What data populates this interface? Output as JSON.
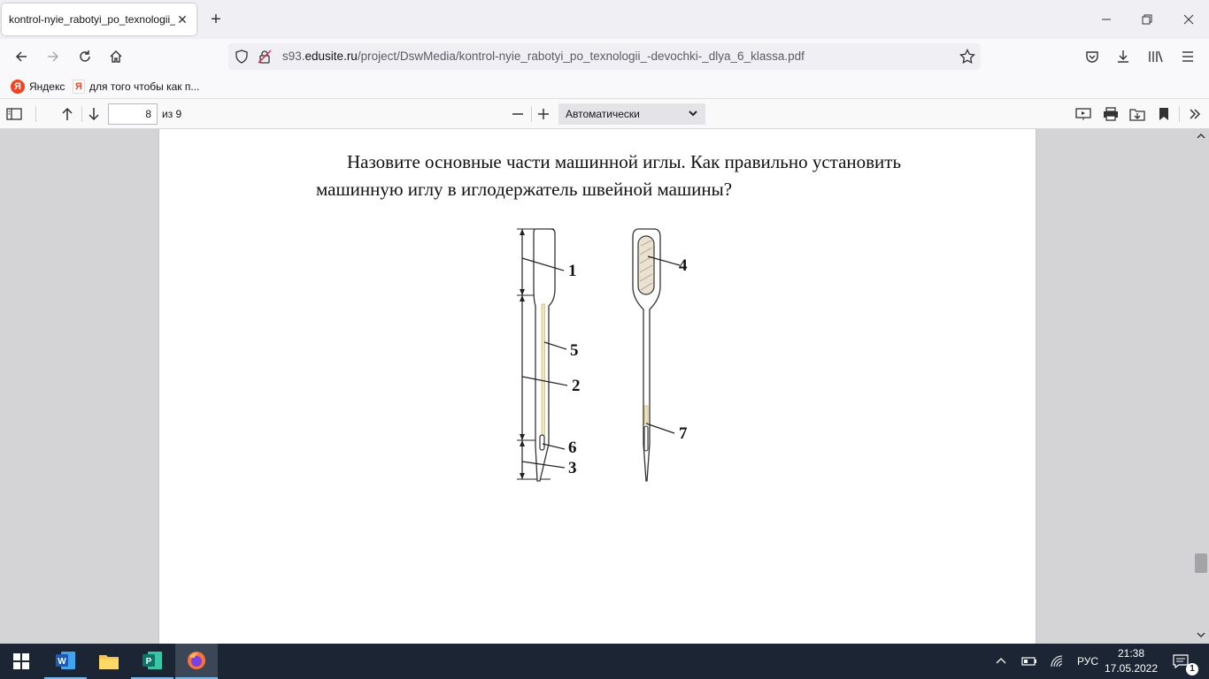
{
  "browser": {
    "tab_title": "kontrol-nyie_rabotyi_po_texnologii_",
    "url_prefix": "s93.",
    "url_domain": "edusite.ru",
    "url_path": "/project/DswMedia/kontrol-nyie_rabotyi_po_texnologii_-devochki-_dlya_6_klassa.pdf"
  },
  "bookmarks": [
    {
      "label": "Яндекс",
      "icon": "yandex-icon"
    },
    {
      "label": "для того чтобы как п...",
      "icon": "yandex-page-icon"
    }
  ],
  "pdf_toolbar": {
    "page_number": "8",
    "page_count": "из 9",
    "zoom": "Автоматически"
  },
  "document": {
    "question": "Назовите основные части машинной иглы. Как правильно установить машинную иглу в иглодержатель швейной машины?",
    "figure_labels": [
      "1",
      "5",
      "2",
      "6",
      "3",
      "4",
      "7"
    ]
  },
  "taskbar": {
    "lang": "РУС",
    "time": "21:38",
    "date": "17.05.2022",
    "notifications": "1"
  },
  "colors": {
    "taskbar": "#1b2533",
    "accent": "#76b9ed"
  }
}
